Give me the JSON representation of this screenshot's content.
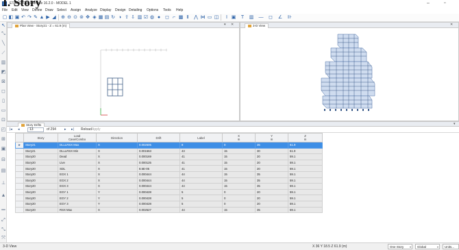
{
  "overlay_title": "I. Story",
  "window": {
    "title": "ETABS 2016 Ultimate 16.2.0 - MODEL 1",
    "minimize": "–",
    "restore": "▫"
  },
  "menu": [
    "File",
    "Edit",
    "View",
    "Define",
    "Draw",
    "Select",
    "Assign",
    "Analyze",
    "Display",
    "Design",
    "Detailing",
    "Options",
    "Tools",
    "Help"
  ],
  "plan_view": {
    "tab_label": "Plan View - Story21 - Z = 61.9 (m)",
    "close": "✕"
  },
  "view3d": {
    "tab_label": "3-D View",
    "close": "✕"
  },
  "story_drifts": {
    "tab_label": "Story Drifts",
    "nav": {
      "current": "13",
      "of_label": "of 294",
      "reload": "Reload",
      "apply": "Apply"
    },
    "columns": [
      {
        "label": "Story",
        "unit": ""
      },
      {
        "label": "Load\nCase/Combo",
        "unit": ""
      },
      {
        "label": "Direction",
        "unit": ""
      },
      {
        "label": "Drift",
        "unit": ""
      },
      {
        "label": "Label",
        "unit": ""
      },
      {
        "label": "X",
        "unit": "m"
      },
      {
        "label": "Y",
        "unit": "m"
      },
      {
        "label": "Z",
        "unit": "m"
      }
    ],
    "rows": [
      [
        "Story21",
        "DLLLRSX Max",
        "X",
        "0.002505",
        "8",
        "0",
        "35",
        "61.9"
      ],
      [
        "Story21",
        "DLLLRSX Min",
        "X",
        "0.001563",
        "43",
        "15",
        "30",
        "61.9"
      ],
      [
        "Story20",
        "Dead",
        "X",
        "0.000169",
        "41",
        "15",
        "20",
        "59.1"
      ],
      [
        "Story20",
        "Live",
        "X",
        "0.000125",
        "41",
        "15",
        "20",
        "59.1"
      ],
      [
        "Story20",
        "SDL",
        "X",
        "8.6E-05",
        "41",
        "15",
        "20",
        "59.1"
      ],
      [
        "Story20",
        "EGX 1",
        "X",
        "0.000444",
        "44",
        "15",
        "35",
        "59.1"
      ],
      [
        "Story20",
        "EGX 2",
        "X",
        "0.000444",
        "44",
        "15",
        "35",
        "59.1"
      ],
      [
        "Story20",
        "EGX 3",
        "X",
        "0.000444",
        "44",
        "15",
        "35",
        "59.1"
      ],
      [
        "Story20",
        "EGY 1",
        "Y",
        "0.000428",
        "5",
        "0",
        "20",
        "59.1"
      ],
      [
        "Story20",
        "EGY 2",
        "Y",
        "0.000428",
        "5",
        "0",
        "20",
        "59.1"
      ],
      [
        "Story20",
        "EGY 3",
        "Y",
        "0.000428",
        "5",
        "0",
        "20",
        "59.1"
      ],
      [
        "Story20",
        "RSX Max",
        "X",
        "0.002527",
        "44",
        "15",
        "35",
        "59.1"
      ]
    ]
  },
  "status": {
    "left": "3-D View",
    "coords": "X 36  Y 18.5  Z 61.9 (m)",
    "story_mode": "One Story",
    "coord_system": "Global",
    "units": "Units..."
  },
  "colors": {
    "selection": "#3d8ee6",
    "accent": "#2c62a8"
  }
}
